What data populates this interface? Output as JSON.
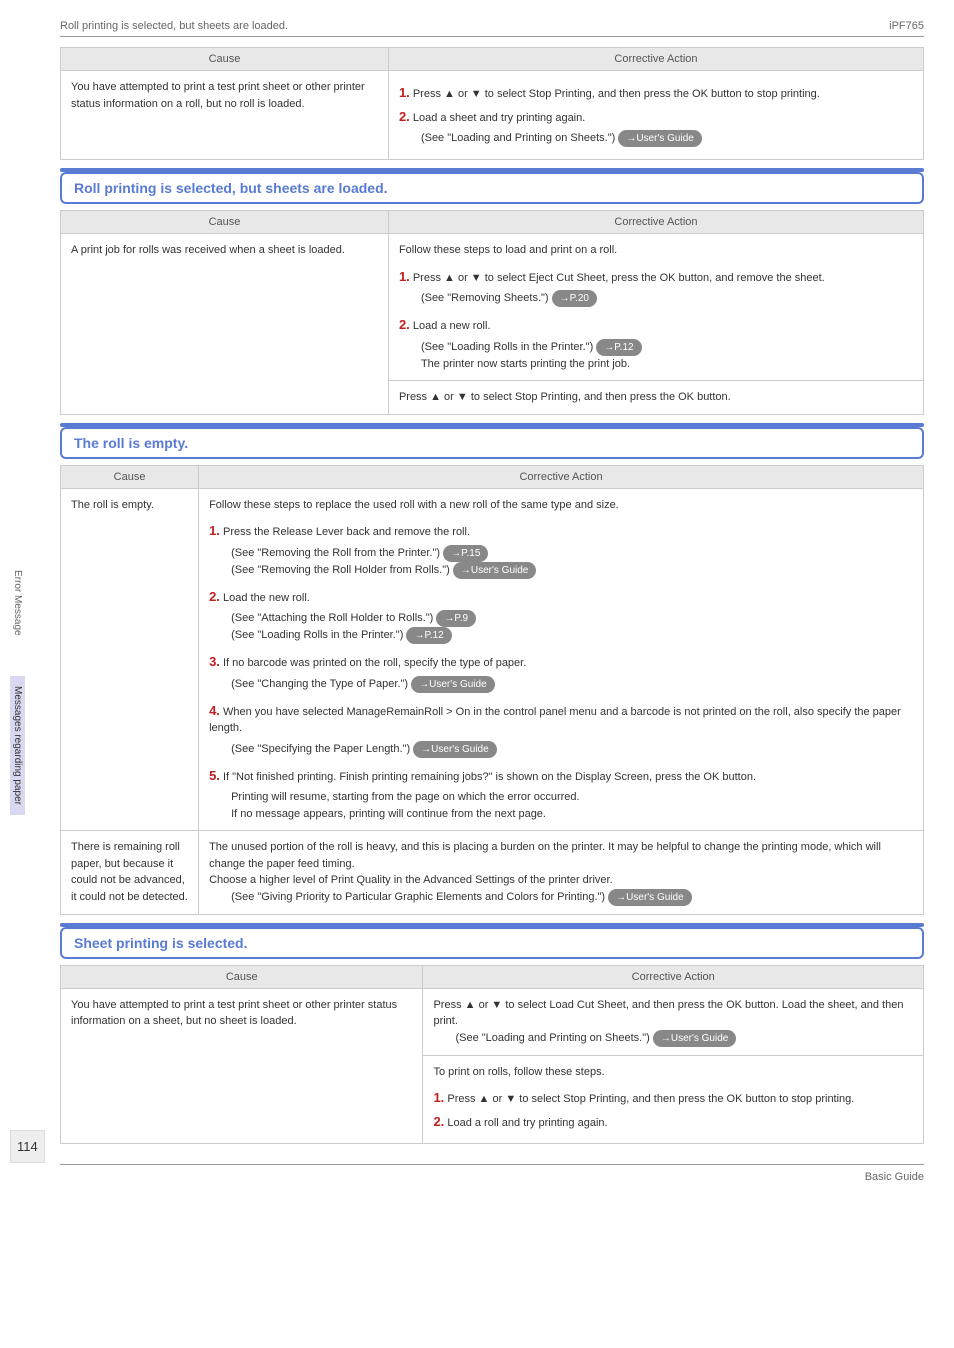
{
  "header": {
    "left": "Roll printing is selected, but sheets are loaded.",
    "right": "iPF765"
  },
  "sideTabs": {
    "tab1": "Error Message",
    "tab2": "Messages regarding paper"
  },
  "pageNumber": "114",
  "footer": "Basic Guide",
  "columns": {
    "cause": "Cause",
    "action": "Corrective Action"
  },
  "table0": {
    "cause": "You have attempted to print a test print sheet or other printer status information on a roll, but no roll is loaded.",
    "step1": "Press ▲ or ▼ to select Stop Printing, and then press the OK button to stop printing.",
    "step2": "Load a sheet and try printing again.",
    "see1": "(See \"Loading and Printing on Sheets.\")",
    "badge1": "→User's Guide"
  },
  "section1": {
    "title": "Roll printing is selected, but sheets are loaded."
  },
  "table1": {
    "cause": "A print job for rolls was received when a sheet is loaded.",
    "intro": "Follow these steps to load and print on a roll.",
    "step1": "Press ▲ or ▼ to select Eject Cut Sheet, press the OK button, and remove the sheet.",
    "see1": "(See \"Removing Sheets.\")",
    "badge1": "→P.20",
    "step2": "Load a new roll.",
    "see2": "(See \"Loading Rolls in the Printer.\")",
    "badge2": "→P.12",
    "line2b": "The printer now starts printing the print job.",
    "final": "Press ▲ or ▼ to select Stop Printing, and then press the OK button."
  },
  "section2": {
    "title": "The roll is empty."
  },
  "table2a": {
    "cause": "The roll is empty.",
    "intro": "Follow these steps to replace the used roll with a new roll of the same type and size.",
    "s1": "Press the Release Lever back and remove the roll.",
    "s1a": "(See \"Removing the Roll from the Printer.\")",
    "s1ab": "→P.15",
    "s1b": "(See \"Removing the Roll Holder from Rolls.\")",
    "s1bb": "→User's Guide",
    "s2": "Load the new roll.",
    "s2a": "(See \"Attaching the Roll Holder to Rolls.\")",
    "s2ab": "→P.9",
    "s2b": "(See \"Loading Rolls in the Printer.\")",
    "s2bb": "→P.12",
    "s3": "If no barcode was printed on the roll, specify the type of paper.",
    "s3a": "(See \"Changing the Type of Paper.\")",
    "s3ab": "→User's Guide",
    "s4": "When you have selected ManageRemainRoll > On in the control panel menu and a barcode is not printed on the roll, also specify the paper length.",
    "s4a": "(See \"Specifying the Paper Length.\")",
    "s4ab": "→User's Guide",
    "s5": "If \"Not finished printing. Finish printing remaining jobs?\" is shown on the Display Screen, press the OK button.",
    "s5a": "Printing will resume, starting from the page on which the error occurred.",
    "s5b": "If no message appears, printing will continue from the next page."
  },
  "table2b": {
    "cause": "There is remaining roll paper, but because it could not be advanced, it could not be detected.",
    "l1": "The unused portion of the roll is heavy, and this is placing a burden on the printer. It may be helpful to change the printing mode, which will change the paper feed timing.",
    "l2": "Choose a higher level of Print Quality in the Advanced Settings of the printer driver.",
    "l3": "(See \"Giving Priority to Particular Graphic Elements and Colors for Printing.\")",
    "l3b": "→User's Guide"
  },
  "section3": {
    "title": "Sheet printing is selected."
  },
  "table3": {
    "cause": "You have attempted to print a test print sheet or other printer status information on a sheet, but no sheet is loaded.",
    "r1a": "Press ▲ or ▼ to select Load Cut Sheet, and then press the OK button. Load the sheet, and then print.",
    "r1b": "(See \"Loading and Printing on Sheets.\")",
    "r1bb": "→User's Guide",
    "r2intro": "To print on rolls, follow these steps.",
    "r2s1": "Press ▲ or ▼ to select Stop Printing, and then press the OK button to stop printing.",
    "r2s2": "Load a roll and try printing again."
  }
}
